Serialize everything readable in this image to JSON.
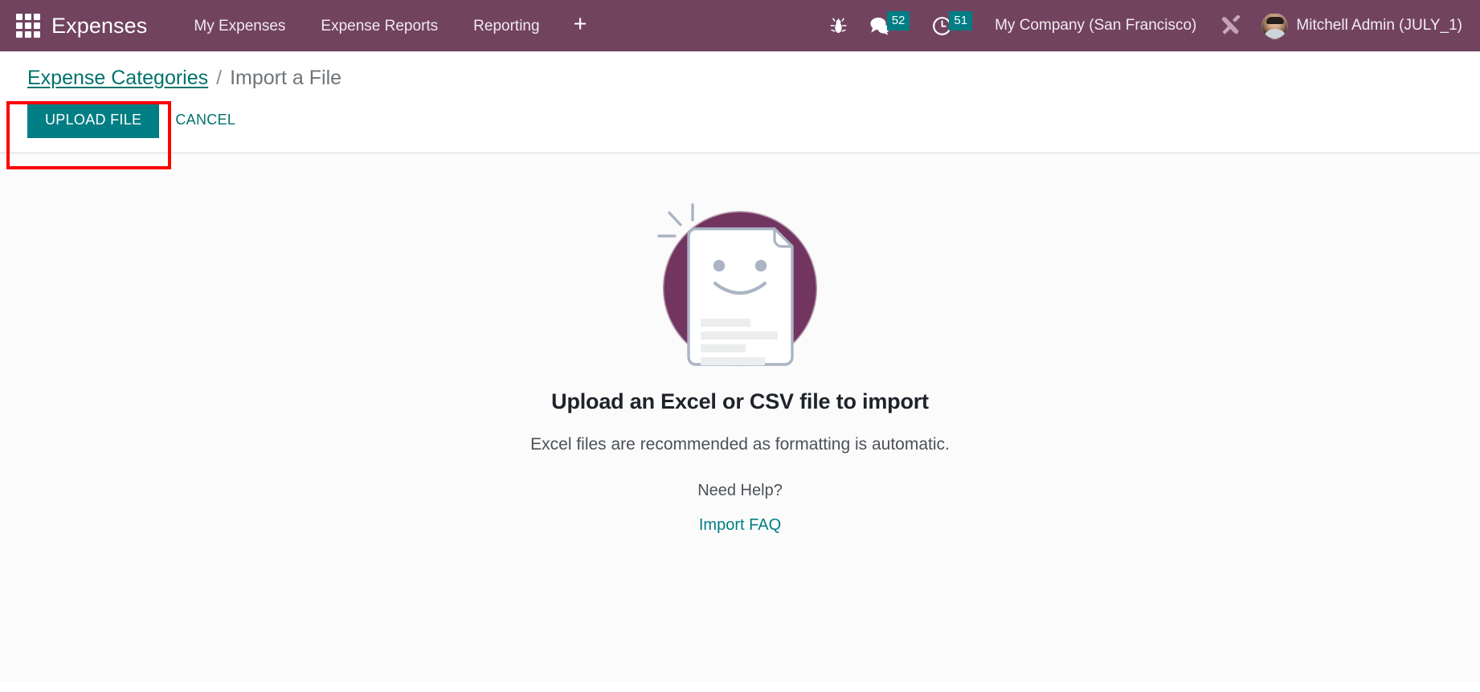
{
  "navbar": {
    "apps_icon": "apps-grid-icon",
    "brand": "Expenses",
    "menu": [
      {
        "label": "My Expenses",
        "name": "nav-my-expenses"
      },
      {
        "label": "Expense Reports",
        "name": "nav-expense-reports"
      },
      {
        "label": "Reporting",
        "name": "nav-reporting"
      }
    ],
    "plus_label": "+",
    "systray": {
      "bug_icon": "bug-icon",
      "messages_icon": "chat-bubbles-icon",
      "messages_count": "52",
      "activities_icon": "clock-icon",
      "activities_count": "51",
      "company": "My Company (San Francisco)",
      "tools_icon": "wrench-screwdriver-icon",
      "avatar_icon": "user-avatar",
      "user": "Mitchell Admin (JULY_1)"
    }
  },
  "breadcrumb": {
    "parent": "Expense Categories",
    "separator": "/",
    "current": "Import a File"
  },
  "actions": {
    "upload_label": "UPLOAD FILE",
    "cancel_label": "CANCEL"
  },
  "main": {
    "illustration_name": "smiling-document-illustration",
    "heading": "Upload an Excel or CSV file to import",
    "subtext": "Excel files are recommended as formatting is automatic.",
    "need_help": "Need Help?",
    "faq_link": "Import FAQ"
  },
  "colors": {
    "navbar_bg": "#71435f",
    "accent_teal": "#017e84",
    "link_teal": "#00736b",
    "badge_teal": "#017e84",
    "highlight_red": "#ff0000",
    "illustration_circle": "#71355f",
    "illustration_doc_outline": "#aab4c4"
  }
}
